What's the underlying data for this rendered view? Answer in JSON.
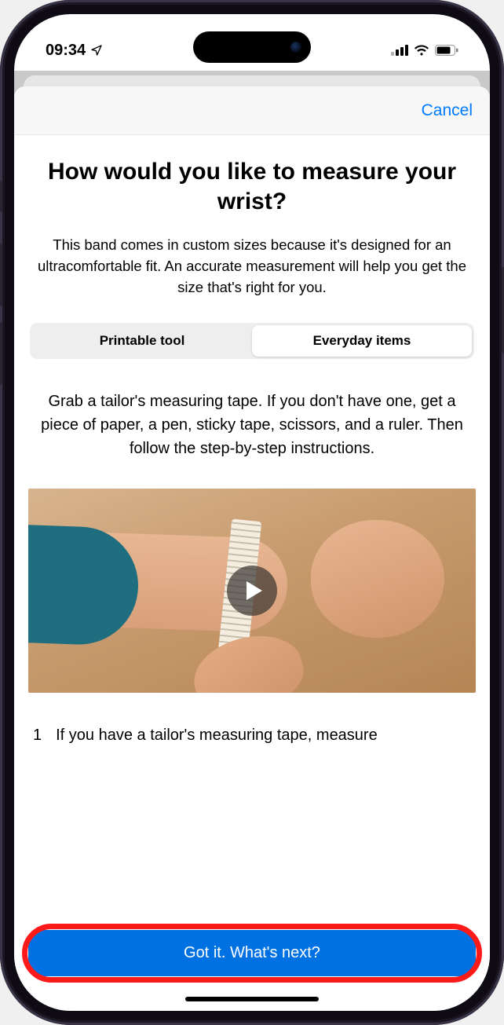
{
  "status": {
    "time": "09:34"
  },
  "header": {
    "cancel": "Cancel"
  },
  "title": "How would you like to measure your wrist?",
  "subtitle": "This band comes in custom sizes because it's designed for an ultracomfortable fit. An accurate measurement will help you get the size that's right for you.",
  "segmented": {
    "options": [
      "Printable tool",
      "Everyday items"
    ],
    "selected": 1
  },
  "instructions": "Grab a tailor's measuring tape. If you don't have one, get a piece of paper, a pen, sticky tape, scissors, and a ruler. Then follow the step-by-step instructions.",
  "steps": [
    {
      "num": "1",
      "text": "If you have a tailor's measuring tape, measure"
    }
  ],
  "cta": "Got it. What's next?",
  "colors": {
    "accent": "#007aff",
    "cta_bg": "#0071e3",
    "highlight": "#ff1a1a"
  }
}
